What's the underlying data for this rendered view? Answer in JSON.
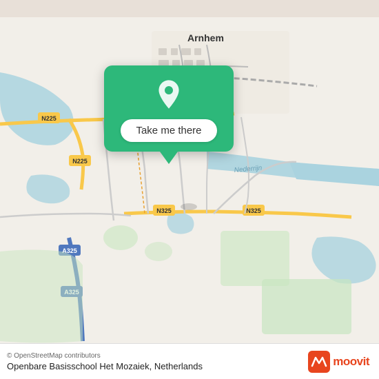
{
  "map": {
    "background_color": "#e8e0d8",
    "city": "Arnhem",
    "country": "Netherlands"
  },
  "popup": {
    "button_label": "Take me there",
    "background_color": "#2db87a"
  },
  "bottom_bar": {
    "copyright": "© OpenStreetMap contributors",
    "location_name": "Openbare Basisschool Het Mozaiek, Netherlands"
  },
  "moovit": {
    "text": "moovit",
    "icon_color": "#e8451e"
  }
}
